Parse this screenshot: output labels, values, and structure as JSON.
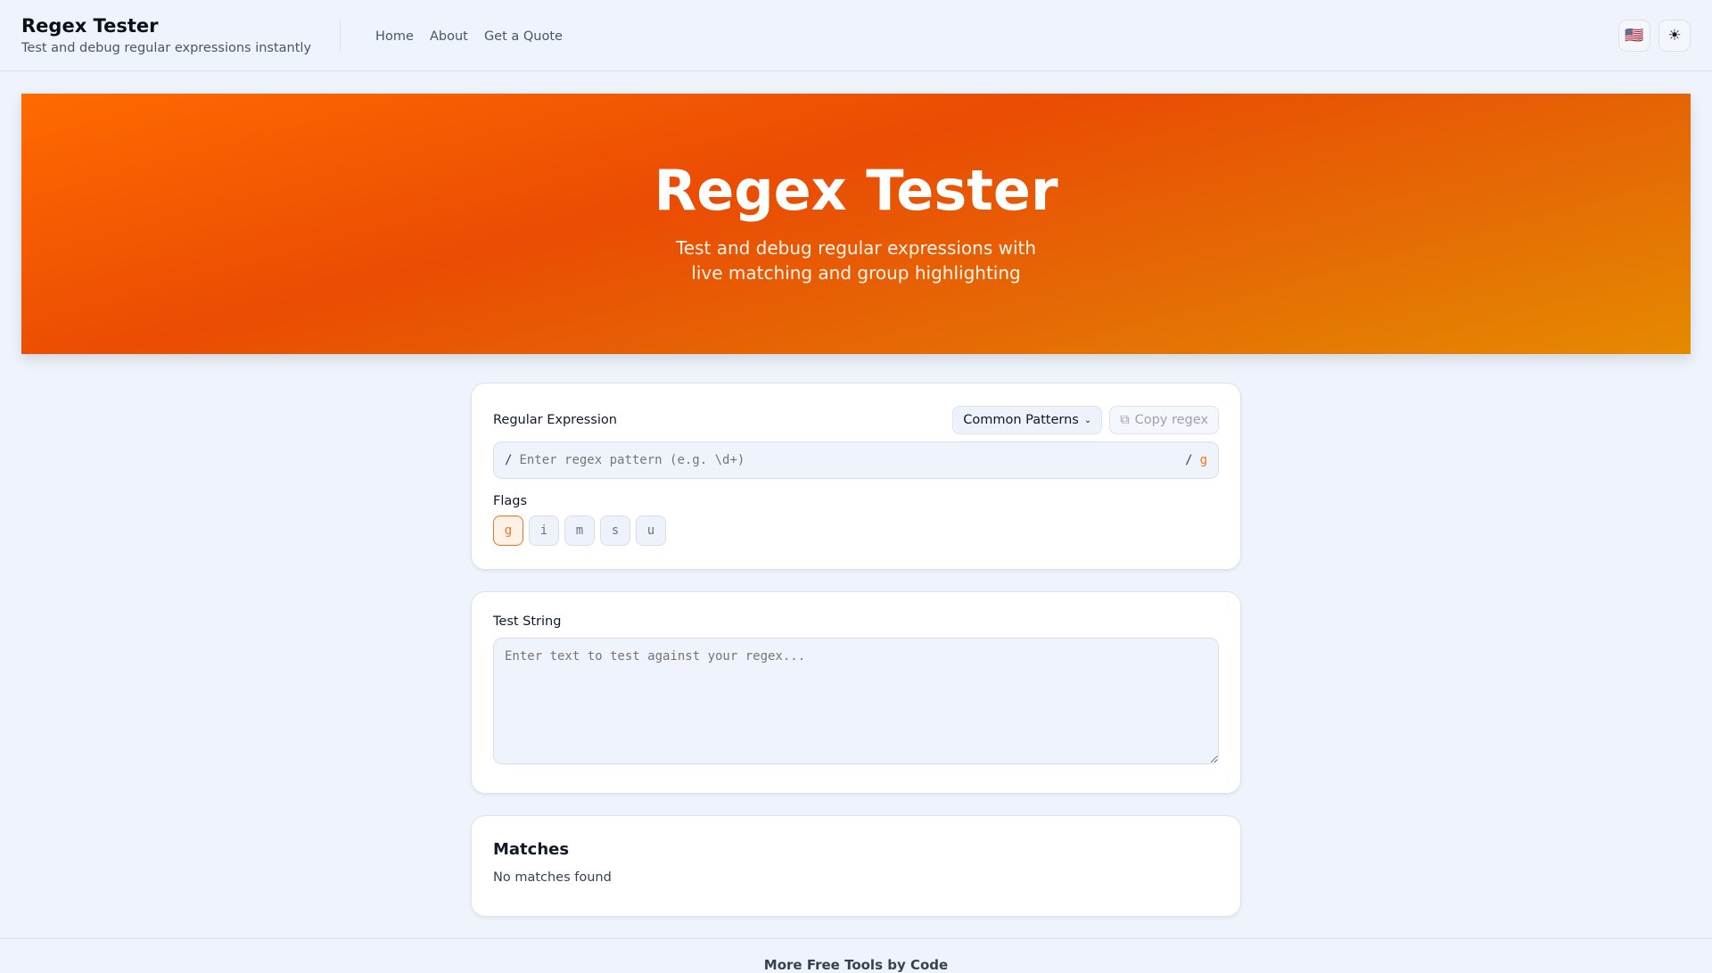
{
  "header": {
    "title": "Regex Tester",
    "subtitle": "Test and debug regular expressions instantly",
    "nav": [
      "Home",
      "About",
      "Get a Quote"
    ],
    "lang_icon": "🇺🇸",
    "theme_icon": "☀"
  },
  "hero": {
    "title": "Regex Tester",
    "line1": "Test and debug regular expressions with",
    "line2": "live matching and group highlighting"
  },
  "regex": {
    "label": "Regular Expression",
    "patterns_label": "Common Patterns",
    "copy_label": "Copy regex",
    "open_slash": "/",
    "close_slash": "/",
    "placeholder": "Enter regex pattern (e.g. \\d+)",
    "active_flags": "g",
    "flags_label": "Flags",
    "flags": [
      "g",
      "i",
      "m",
      "s",
      "u"
    ]
  },
  "test": {
    "label": "Test String",
    "placeholder": "Enter text to test against your regex..."
  },
  "matches": {
    "title": "Matches",
    "empty": "No matches found"
  },
  "footer": {
    "title": "More Free Tools by Code"
  },
  "colors": {
    "accent": "#f97316"
  }
}
